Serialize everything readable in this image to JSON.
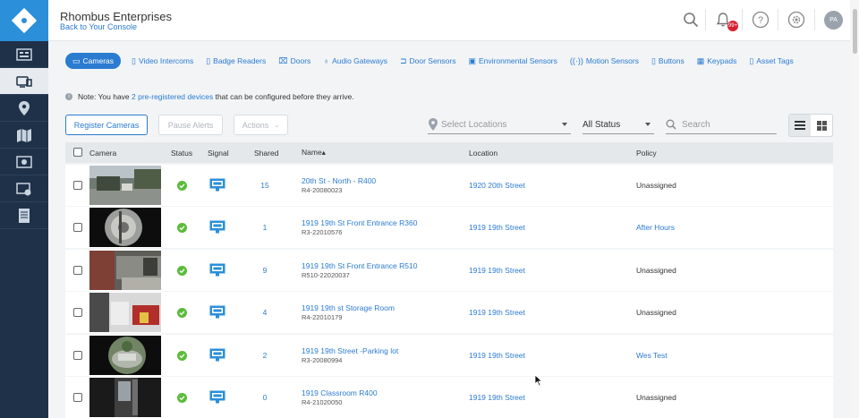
{
  "header": {
    "org_name": "Rhombus Enterprises",
    "back_link": "Back to Your Console",
    "notification_badge": "99+",
    "avatar_initials": "PA"
  },
  "sidebar": {
    "items": [
      "dashboard-icon",
      "devices-icon",
      "map-pin-icon",
      "map-icon",
      "video-wall-icon",
      "clips-icon",
      "reports-icon"
    ],
    "active_index": 1
  },
  "tabs": [
    {
      "label": "Cameras",
      "icon": "camera-icon",
      "active": true
    },
    {
      "label": "Video Intercoms",
      "icon": "intercom-icon"
    },
    {
      "label": "Badge Readers",
      "icon": "badge-reader-icon"
    },
    {
      "label": "Doors",
      "icon": "door-icon"
    },
    {
      "label": "Audio Gateways",
      "icon": "microphone-icon"
    },
    {
      "label": "Door Sensors",
      "icon": "door-sensor-icon"
    },
    {
      "label": "Environmental Sensors",
      "icon": "environment-sensor-icon"
    },
    {
      "label": "Motion Sensors",
      "icon": "motion-sensor-icon"
    },
    {
      "label": "Buttons",
      "icon": "button-device-icon"
    },
    {
      "label": "Keypads",
      "icon": "keypad-icon"
    },
    {
      "label": "Asset Tags",
      "icon": "asset-tag-icon"
    }
  ],
  "notice": {
    "prefix": "Note: You have ",
    "link": "2 pre-registered devices",
    "suffix": " that can be configured before they arrive."
  },
  "toolbar": {
    "register": "Register Cameras",
    "pause": "Pause Alerts",
    "actions": "Actions",
    "location_placeholder": "Select Locations",
    "status_value": "All Status",
    "search_placeholder": "Search"
  },
  "table": {
    "headers": {
      "camera": "Camera",
      "status": "Status",
      "signal": "Signal",
      "shared": "Shared",
      "name": "Name▴",
      "location": "Location",
      "policy": "Policy"
    },
    "rows": [
      {
        "shared": "15",
        "name": "20th St - North - R400",
        "serial": "R4-20080023",
        "location": "1920 20th Street",
        "policy": "Unassigned",
        "policy_link": false,
        "thumb": "outdoor"
      },
      {
        "shared": "1",
        "name": "1919 19th St Front Entrance R360",
        "serial": "R3-22010576",
        "location": "1919 19th Street",
        "policy": "After Hours",
        "policy_link": true,
        "thumb": "fisheye"
      },
      {
        "shared": "9",
        "name": "1919 19th St Front Entrance R510",
        "serial": "R510-22020037",
        "location": "1919 19th Street",
        "policy": "Unassigned",
        "policy_link": false,
        "thumb": "entrance"
      },
      {
        "shared": "4",
        "name": "1919 19th st Storage Room",
        "serial": "R4-22010179",
        "location": "1919 19th Street",
        "policy": "Unassigned",
        "policy_link": false,
        "thumb": "storage"
      },
      {
        "shared": "2",
        "name": "1919 19th Street -Parking lot",
        "serial": "R3-20080994",
        "location": "1919 19th Street",
        "policy": "Wes Test",
        "policy_link": true,
        "thumb": "parking"
      },
      {
        "shared": "0",
        "name": "1919 Classroom R400",
        "serial": "R4-21020050",
        "location": "1919 19th Street",
        "policy": "Unassigned",
        "policy_link": false,
        "thumb": "classroom"
      }
    ]
  }
}
